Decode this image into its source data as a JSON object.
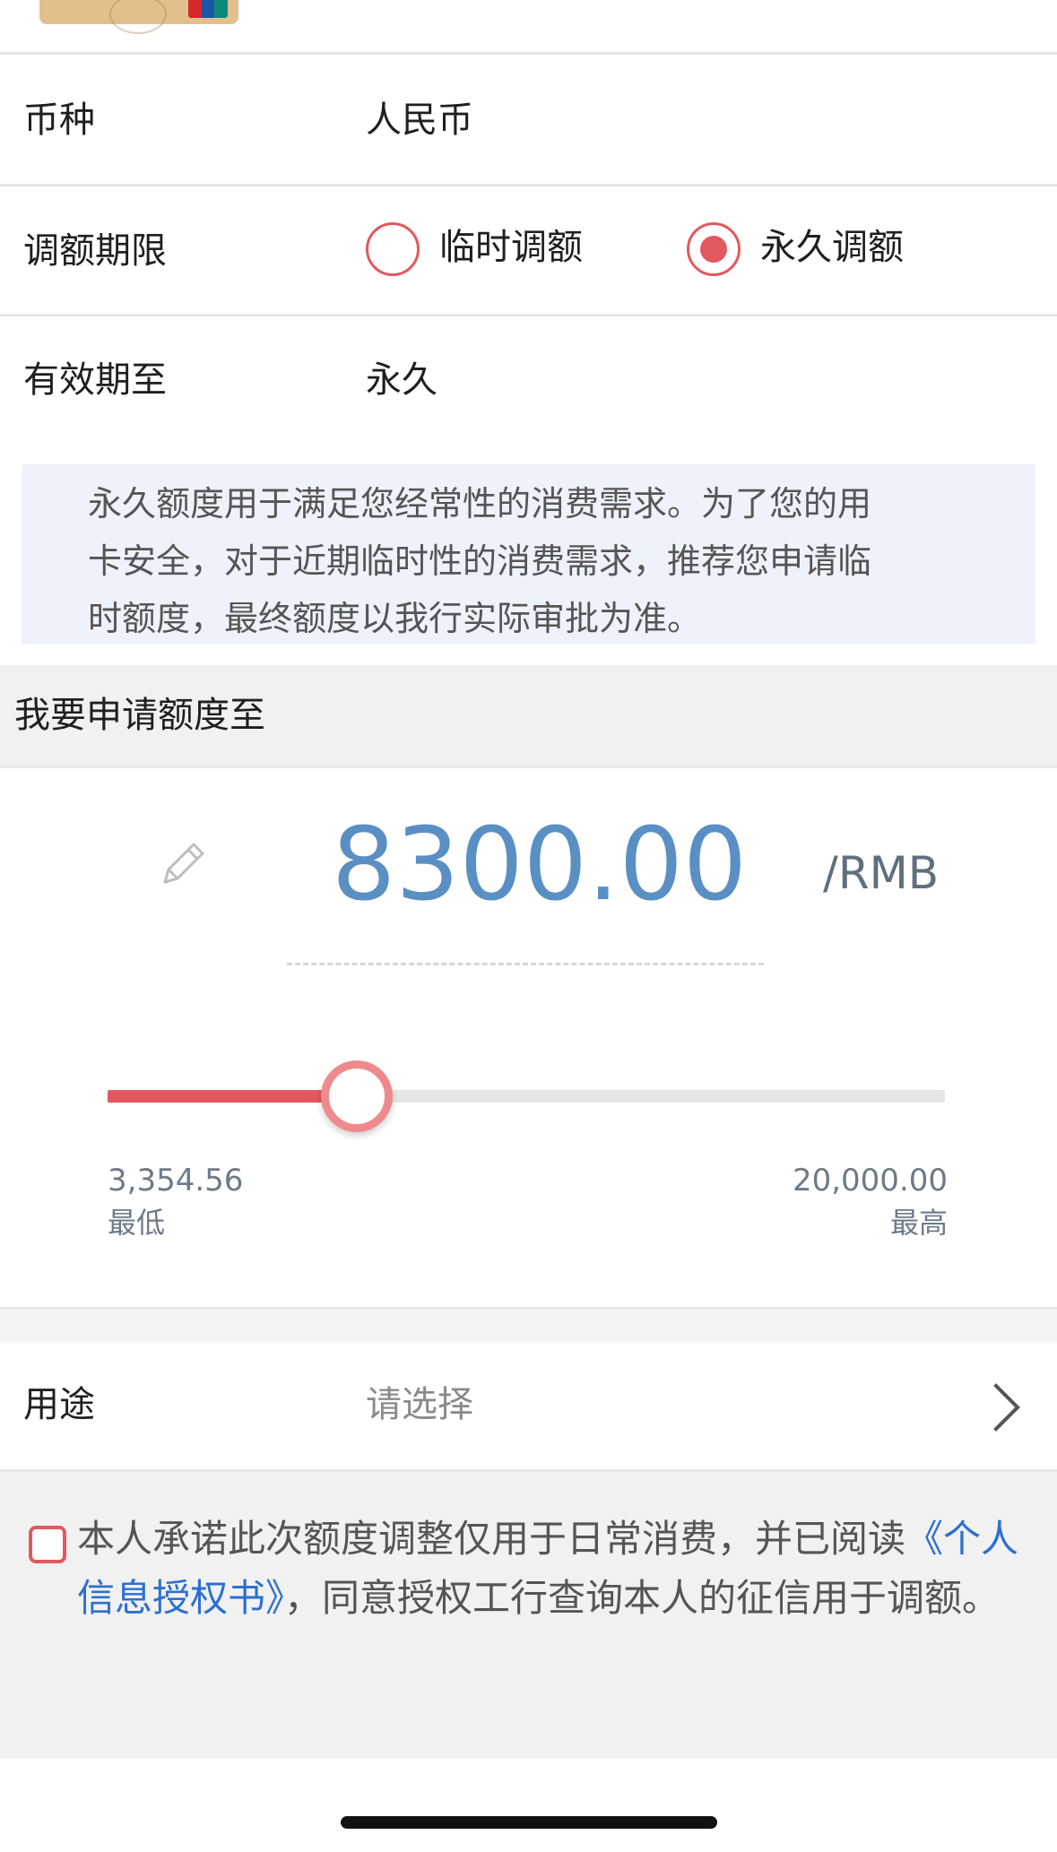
{
  "top_card": {
    "icon": "unionpay-card-thumbnail"
  },
  "currency": {
    "label": "币种",
    "value": "人民币"
  },
  "adjust_period": {
    "label": "调额期限",
    "options": [
      {
        "label": "临时调额",
        "selected": false
      },
      {
        "label": "永久调额",
        "selected": true
      }
    ]
  },
  "valid_until": {
    "label": "有效期至",
    "value": "永久"
  },
  "info_notice": {
    "lines": [
      "永久额度用于满足您经常性的消费需求。为了您的用",
      "卡安全，对于近期临时性的消费需求，推荐您申请临",
      "时额度，最终额度以我行实际审批为准。"
    ]
  },
  "apply_section": {
    "title": "我要申请额度至"
  },
  "amount": {
    "value": "8300.00",
    "unit": "/RMB",
    "edit_icon": "pencil-icon"
  },
  "slider": {
    "min_value": "3,354.56",
    "min_label": "最低",
    "max_value": "20,000.00",
    "max_label": "最高",
    "fraction": 0.298
  },
  "purpose": {
    "label": "用途",
    "placeholder": "请选择",
    "icon": "chevron-right-icon"
  },
  "consent": {
    "text_before": "本人承诺此次额度调整仅用于日常消费，并已阅读",
    "link": "《个人信息授权书》",
    "text_after": "，同意授权工行查询本人的征信用于调额。",
    "checked": false
  },
  "colors": {
    "accent_red": "#e3585f",
    "amount_blue": "#5a8fc4",
    "link_blue": "#2c6fd1"
  }
}
